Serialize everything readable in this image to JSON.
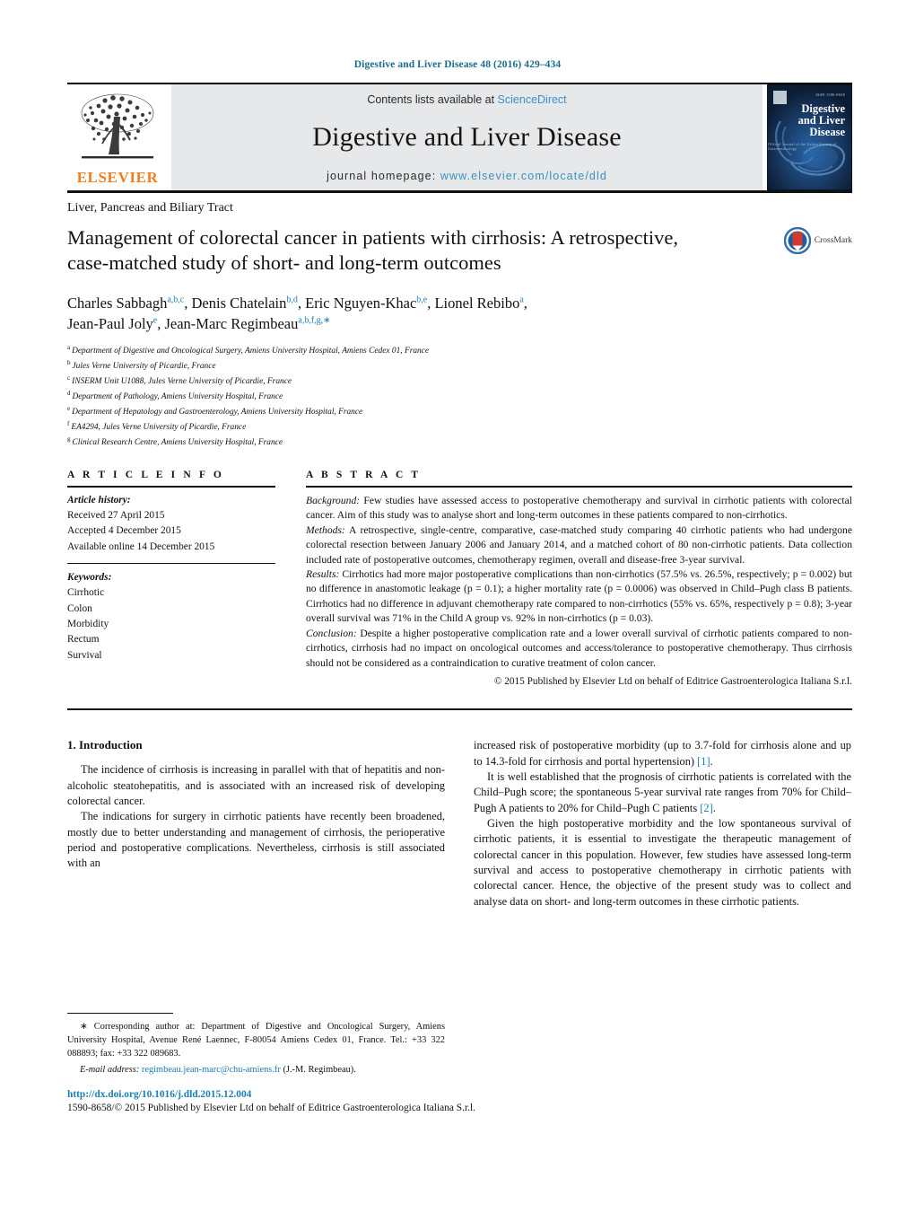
{
  "running_head": "Digestive and Liver Disease 48 (2016) 429–434",
  "masthead": {
    "elsevier_wordmark": "ELSEVIER",
    "contents_prefix": "Contents lists available at ",
    "contents_link": "ScienceDirect",
    "journal_name": "Digestive and Liver Disease",
    "homepage_prefix": "journal homepage: ",
    "homepage_url": "www.elsevier.com/locate/dld",
    "cover_title_line1": "Digestive",
    "cover_title_line2": "and Liver",
    "cover_title_line3": "Disease",
    "cover_subtitle": "Official Journal of the Italian Society of Gastroenterology",
    "cover_header": "ISSN 1590-8658"
  },
  "article": {
    "section_label": "Liver, Pancreas and Biliary Tract",
    "title": "Management of colorectal cancer in patients with cirrhosis: A retrospective, case-matched study of short- and long-term outcomes",
    "crossmark_label": "CrossMark",
    "authors_line1_a": "Charles Sabbagh",
    "authors_line1_a_sup": "a,b,c",
    "authors_line1_b": ", Denis Chatelain",
    "authors_line1_b_sup": "b,d",
    "authors_line1_c": ", Eric Nguyen-Khac",
    "authors_line1_c_sup": "b,e",
    "authors_line1_d": ", Lionel Rebibo",
    "authors_line1_d_sup": "a",
    "authors_line1_end": ",",
    "authors_line2_a": "Jean-Paul Joly",
    "authors_line2_a_sup": "e",
    "authors_line2_b": ", Jean-Marc Regimbeau",
    "authors_line2_b_sup": "a,b,f,g,",
    "authors_line2_star": "∗",
    "affiliations": [
      {
        "marker": "a",
        "text": "Department of Digestive and Oncological Surgery, Amiens University Hospital, Amiens Cedex 01, France"
      },
      {
        "marker": "b",
        "text": "Jules Verne University of Picardie, France"
      },
      {
        "marker": "c",
        "text": "INSERM Unit U1088, Jules Verne University of Picardie, France"
      },
      {
        "marker": "d",
        "text": "Department of Pathology, Amiens University Hospital, France"
      },
      {
        "marker": "e",
        "text": "Department of Hepatology and Gastroenterology, Amiens University Hospital, France"
      },
      {
        "marker": "f",
        "text": "EA4294, Jules Verne University of Picardie, France"
      },
      {
        "marker": "g",
        "text": "Clinical Research Centre, Amiens University Hospital, France"
      }
    ]
  },
  "article_info": {
    "heading": "A R T I C L E   I N F O",
    "history_label": "Article history:",
    "history": [
      "Received 27 April 2015",
      "Accepted 4 December 2015",
      "Available online 14 December 2015"
    ],
    "keywords_label": "Keywords:",
    "keywords": [
      "Cirrhotic",
      "Colon",
      "Morbidity",
      "Rectum",
      "Survival"
    ]
  },
  "abstract": {
    "heading": "A B S T R A C T",
    "background_label": "Background:",
    "background_text": " Few studies have assessed access to postoperative chemotherapy and survival in cirrhotic patients with colorectal cancer. Aim of this study was to analyse short and long-term outcomes in these patients compared to non-cirrhotics.",
    "methods_label": "Methods:",
    "methods_text": " A retrospective, single-centre, comparative, case-matched study comparing 40 cirrhotic patients who had undergone colorectal resection between January 2006 and January 2014, and a matched cohort of 80 non-cirrhotic patients. Data collection included rate of postoperative outcomes, chemotherapy regimen, overall and disease-free 3-year survival.",
    "results_label": "Results:",
    "results_text": " Cirrhotics had more major postoperative complications than non-cirrhotics (57.5% vs. 26.5%, respectively; p = 0.002) but no difference in anastomotic leakage (p = 0.1); a higher mortality rate (p = 0.0006) was observed in Child–Pugh class B patients. Cirrhotics had no difference in adjuvant chemotherapy rate compared to non-cirrhotics (55% vs. 65%, respectively p = 0.8); 3-year overall survival was 71% in the Child A group vs. 92% in non-cirrhotics (p = 0.03).",
    "conclusion_label": "Conclusion:",
    "conclusion_text": " Despite a higher postoperative complication rate and a lower overall survival of cirrhotic patients compared to non-cirrhotics, cirrhosis had no impact on oncological outcomes and access/tolerance to postoperative chemotherapy. Thus cirrhosis should not be considered as a contraindication to curative treatment of colon cancer.",
    "copyright": "© 2015 Published by Elsevier Ltd on behalf of Editrice Gastroenterologica Italiana S.r.l."
  },
  "introduction": {
    "heading": "1.  Introduction",
    "para1": "The incidence of cirrhosis is increasing in parallel with that of hepatitis and non-alcoholic steatohepatitis, and is associated with an increased risk of developing colorectal cancer.",
    "para2": "The indications for surgery in cirrhotic patients have recently been broadened, mostly due to better understanding and management of cirrhosis, the perioperative period and postoperative complications. Nevertheless, cirrhosis is still associated with an",
    "para2_cont": "increased risk of postoperative morbidity (up to 3.7-fold for cirrhosis alone and up to 14.3-fold for cirrhosis and portal hypertension) ",
    "para2_ref": "[1]",
    "para2_end": ".",
    "para3_a": "It is well established that the prognosis of cirrhotic patients is correlated with the Child–Pugh score; the spontaneous 5-year survival rate ranges from 70% for Child–Pugh A patients to 20% for Child–Pugh C patients ",
    "para3_ref": "[2]",
    "para3_end": ".",
    "para4": "Given the high postoperative morbidity and the low spontaneous survival of cirrhotic patients, it is essential to investigate the therapeutic management of colorectal cancer in this population. However, few studies have assessed long-term survival and access to postoperative chemotherapy in cirrhotic patients with colorectal cancer. Hence, the objective of the present study was to collect and analyse data on short- and long-term outcomes in these cirrhotic patients."
  },
  "footer": {
    "corresponding_star": "∗",
    "corresponding_text": " Corresponding author at: Department of Digestive and Oncological Surgery, Amiens University Hospital, Avenue René Laennec, F-80054 Amiens Cedex 01, France. Tel.: +33 322 088893; fax: +33 322 089683.",
    "email_label": "E-mail address:",
    "email_address": "regimbeau.jean-marc@chu-amiens.fr",
    "email_suffix": " (J.-M. Regimbeau).",
    "doi": "http://dx.doi.org/10.1016/j.dld.2015.12.004",
    "issn": "1590-8658/© 2015 Published by Elsevier Ltd on behalf of Editrice Gastroenterologica Italiana S.r.l."
  },
  "colors": {
    "link_blue": "#1a7fb5",
    "band_gray": "#e7e8ea",
    "elsevier_orange": "#f47c20",
    "cover_navy": "#0c1c33"
  }
}
